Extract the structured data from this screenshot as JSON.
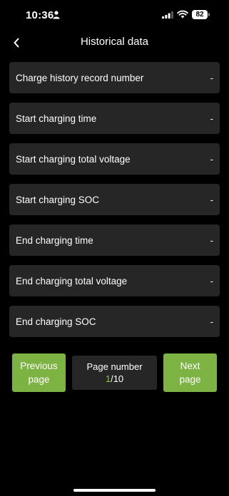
{
  "status_bar": {
    "time": "10:36",
    "battery_level": "82",
    "icons": [
      "person-icon",
      "signal-icon",
      "wifi-icon",
      "battery-icon"
    ]
  },
  "header": {
    "title": "Historical data",
    "back_icon": "chevron-left-icon"
  },
  "records": [
    {
      "label": "Charge history record number",
      "value": "-"
    },
    {
      "label": "Start charging time",
      "value": "-"
    },
    {
      "label": "Start charging total voltage",
      "value": "-"
    },
    {
      "label": "Start charging SOC",
      "value": "-"
    },
    {
      "label": "End charging time",
      "value": "-"
    },
    {
      "label": "End charging total voltage",
      "value": "-"
    },
    {
      "label": "End charging SOC",
      "value": "-"
    }
  ],
  "pagination": {
    "previous_line1": "Previous",
    "previous_line2": "page",
    "page_label": "Page number",
    "current_page": "1",
    "total_pages": "/10",
    "next_line1": "Next",
    "next_line2": "page"
  },
  "colors": {
    "background": "#000000",
    "row_background": "#262626",
    "accent_green": "#7cb342",
    "current_page_green": "#8bc34a"
  }
}
